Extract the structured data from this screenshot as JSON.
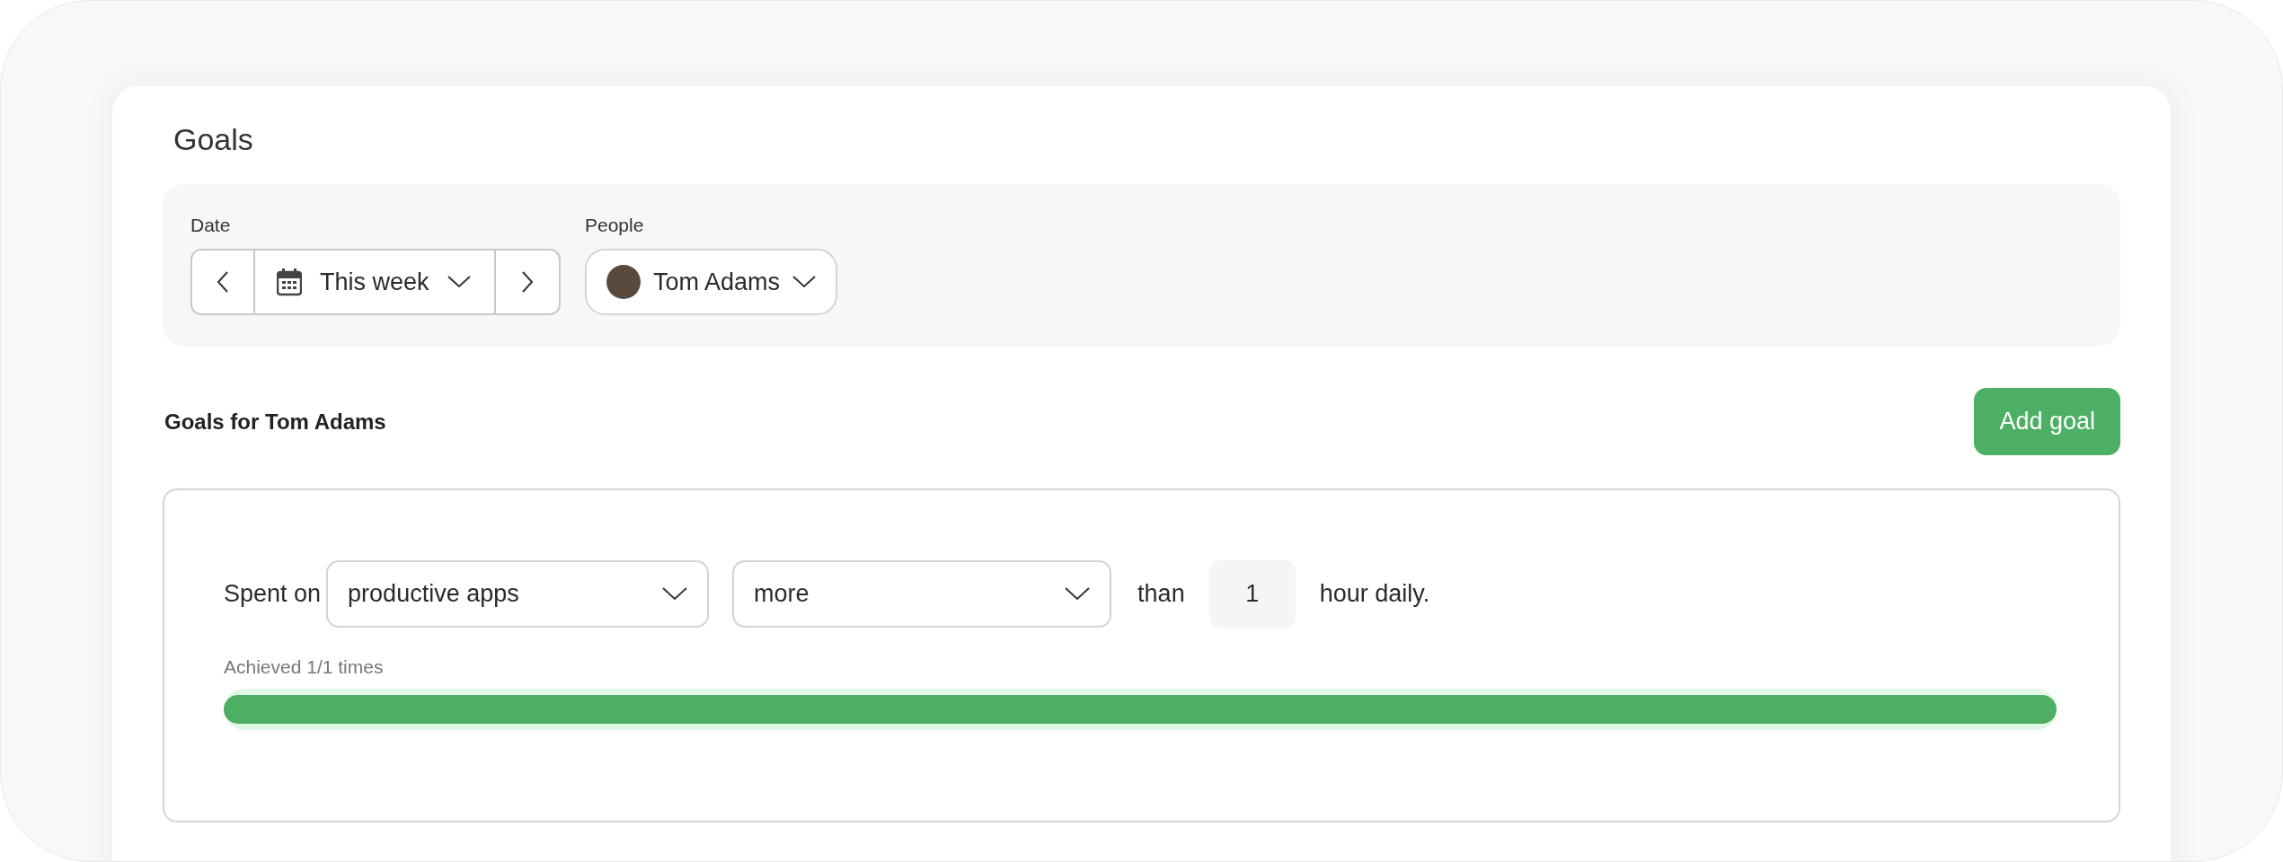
{
  "page_title": "Goals",
  "filters": {
    "date": {
      "label": "Date",
      "value": "This week"
    },
    "people": {
      "label": "People",
      "value": "Tom Adams"
    }
  },
  "section": {
    "title": "Goals for Tom Adams",
    "add_button": "Add goal"
  },
  "goals": [
    {
      "prefix": "Spent on",
      "category": "productive apps",
      "comparison": "more",
      "than": "than",
      "amount": "1",
      "suffix": "hour daily.",
      "achieved": "Achieved 1/1 times",
      "level": 1
    }
  ]
}
